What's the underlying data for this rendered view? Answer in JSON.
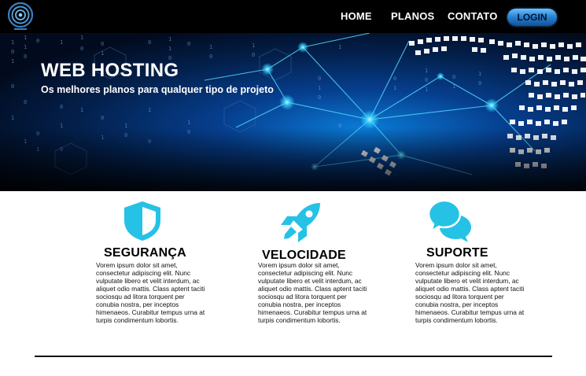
{
  "nav": {
    "logo_icon": "rings-logo-icon",
    "links": [
      {
        "label": "HOME"
      },
      {
        "label": "PLANOS"
      },
      {
        "label": "CONTATO"
      }
    ],
    "login_label": "LOGIN"
  },
  "hero": {
    "title": "WEB HOSTING",
    "subtitle": "Os melhores planos para qualquer tipo de projeto"
  },
  "features": [
    {
      "icon": "shield-icon",
      "title": "SEGURANÇA",
      "text": "Vorem ipsum dolor sit amet, consectetur adipiscing elit. Nunc vulputate libero et velit interdum, ac aliquet odio mattis. Class aptent taciti sociosqu ad litora torquent per conubia nostra, per inceptos himenaeos. Curabitur tempus urna at turpis condimentum lobortis."
    },
    {
      "icon": "rocket-icon",
      "title": "VELOCIDADE",
      "text": "Vorem ipsum dolor sit amet, consectetur adipiscing elit. Nunc vulputate libero et velit interdum, ac aliquet odio mattis. Class aptent taciti sociosqu ad litora torquent per conubia nostra, per inceptos himenaeos. Curabitur tempus urna at turpis condimentum lobortis."
    },
    {
      "icon": "chat-bubbles-icon",
      "title": "SUPORTE",
      "text": "Vorem ipsum dolor sit amet, consectetur adipiscing elit. Nunc vulputate libero et velit interdum, ac aliquet odio mattis. Class aptent taciti sociosqu ad litora torquent per conubia nostra, per inceptos himenaeos. Curabitur tempus urna at turpis condimentum lobortis."
    }
  ],
  "colors": {
    "accent": "#25c2e6",
    "navbar": "#000000",
    "login_button": "#2a86d6"
  }
}
